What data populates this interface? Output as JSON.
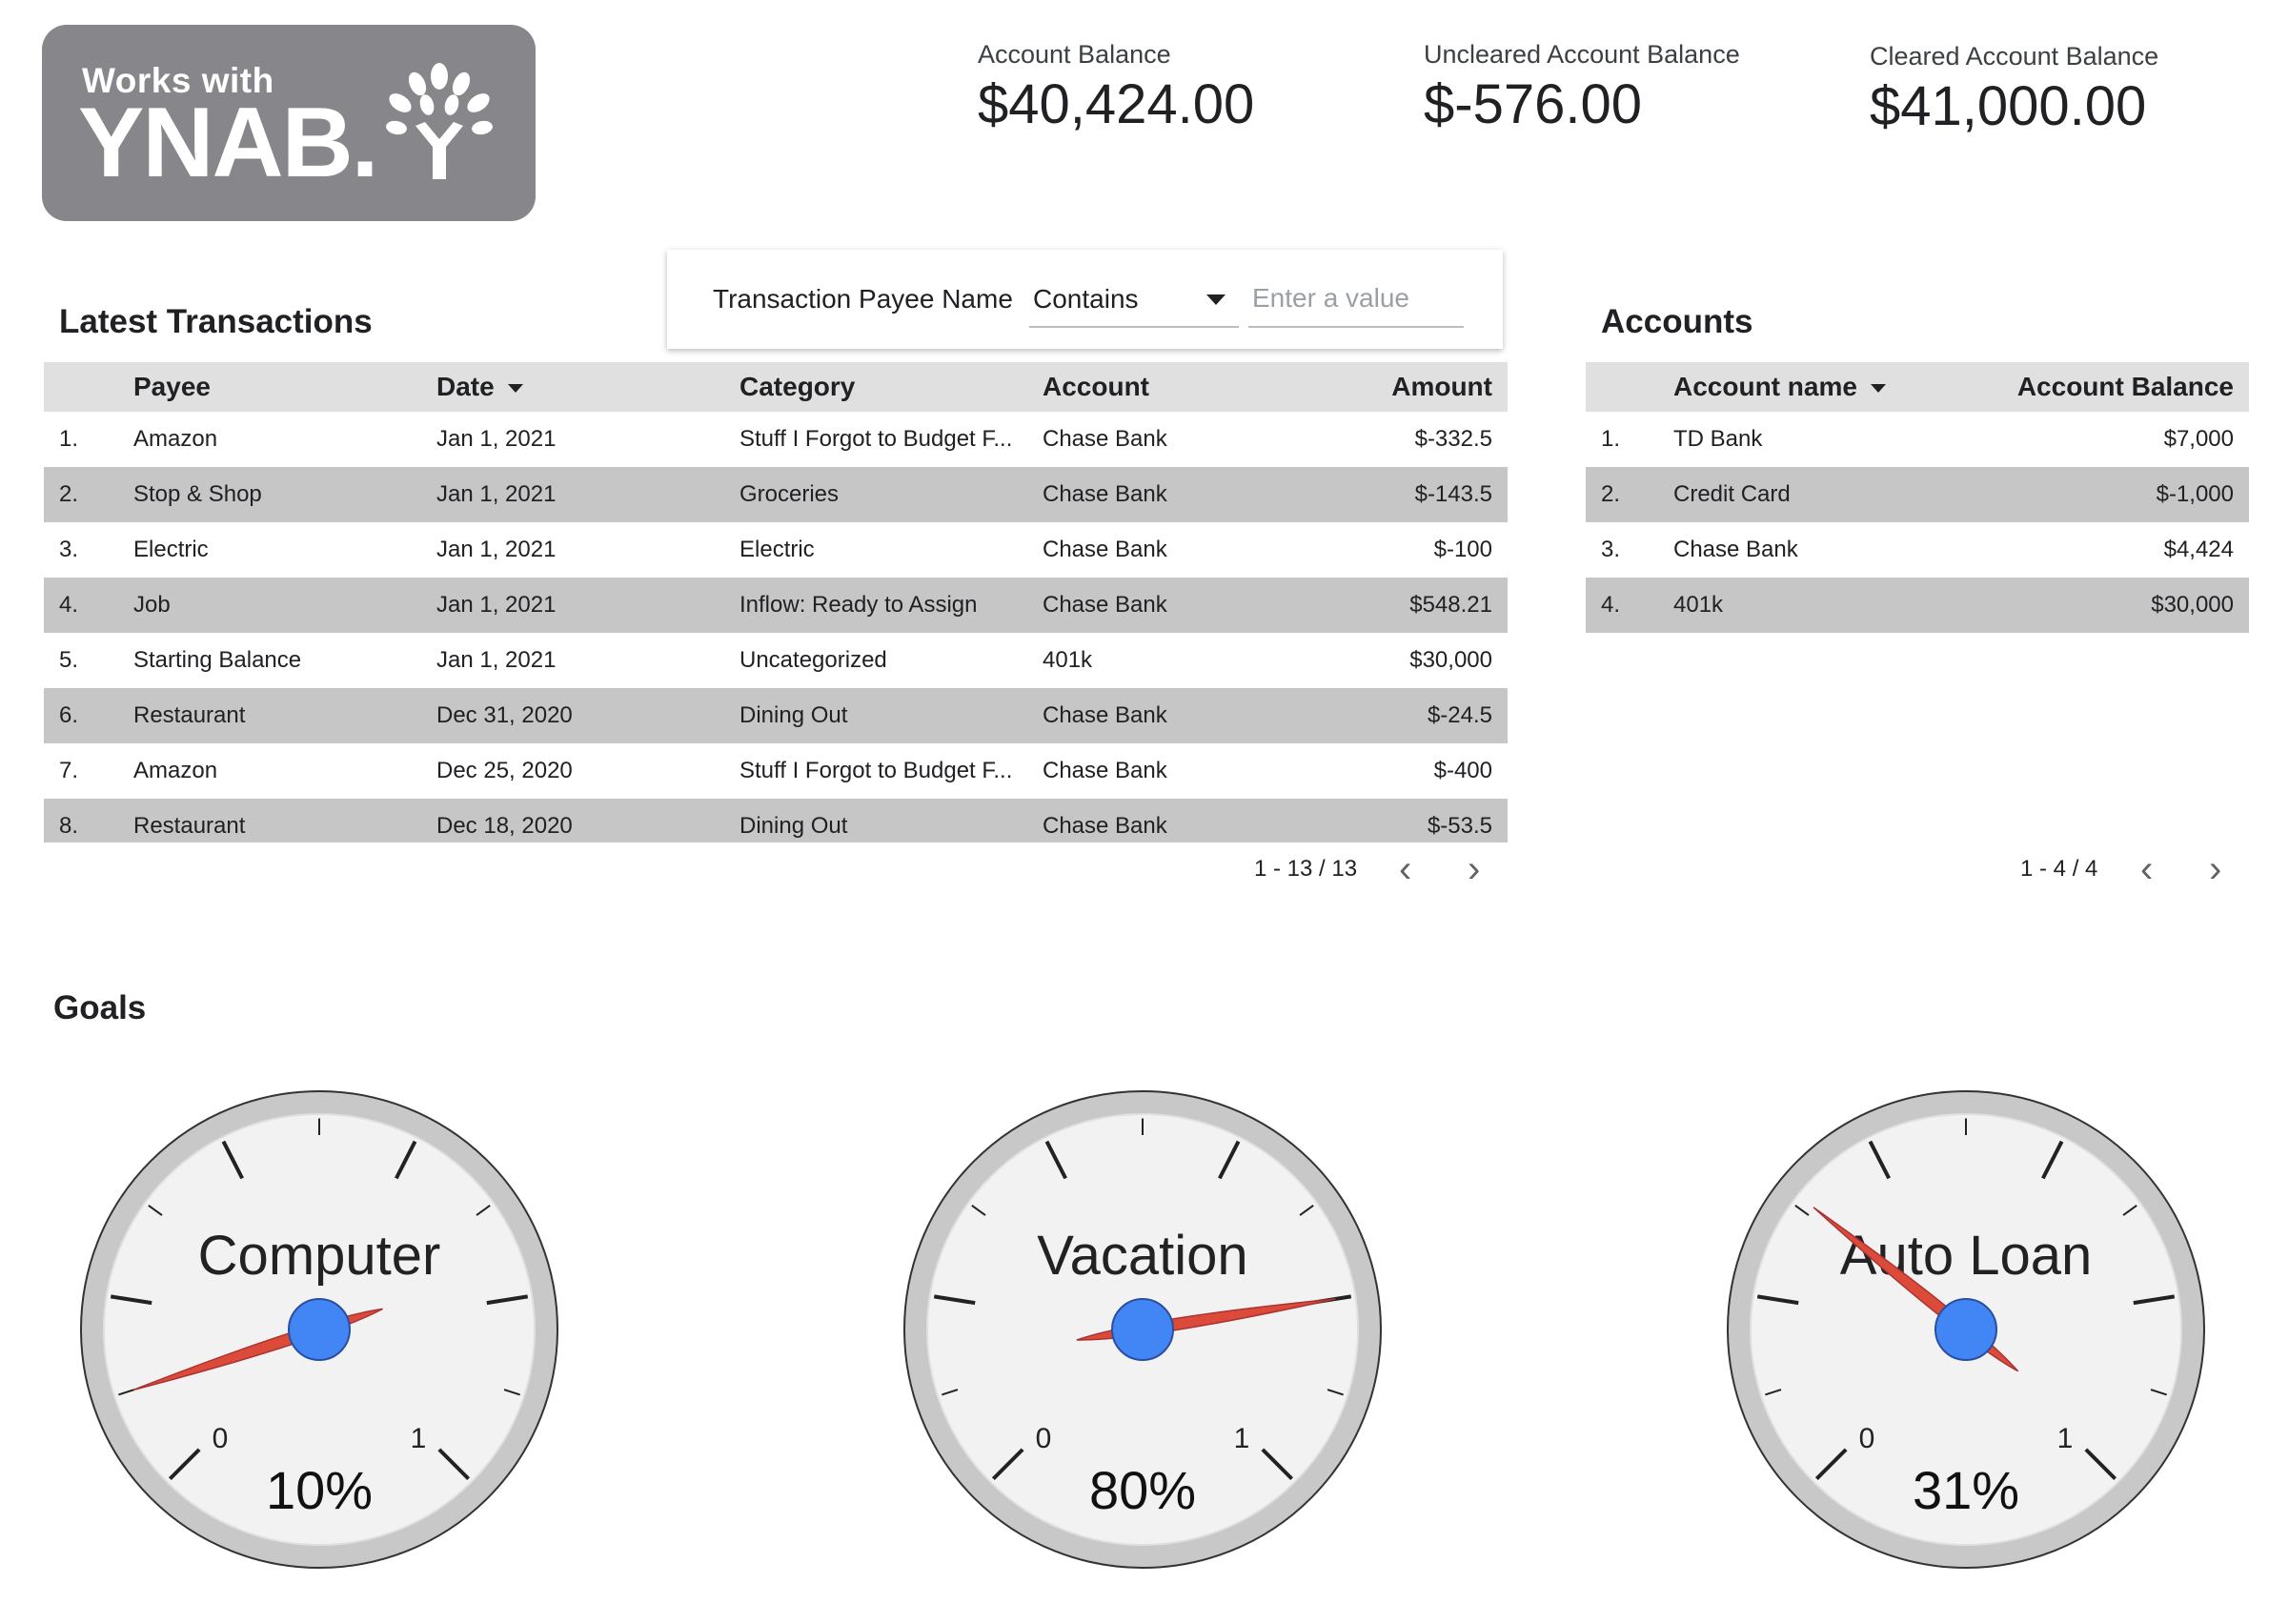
{
  "logo": {
    "line1": "Works with",
    "line2": "YNAB."
  },
  "kpis": [
    {
      "label": "Account Balance",
      "value": "$40,424.00"
    },
    {
      "label": "Uncleared Account Balance",
      "value": "$-576.00"
    },
    {
      "label": "Cleared Account Balance",
      "value": "$41,000.00"
    }
  ],
  "transactions": {
    "title": "Latest Transactions",
    "filter": {
      "label": "Transaction Payee Name",
      "operator": "Contains",
      "placeholder": "Enter a value"
    },
    "columns": [
      "Payee",
      "Date",
      "Category",
      "Account",
      "Amount"
    ],
    "rows": [
      {
        "n": "1.",
        "payee": "Amazon",
        "date": "Jan 1, 2021",
        "category": "Stuff I Forgot to Budget F...",
        "account": "Chase Bank",
        "amount": "$-332.5"
      },
      {
        "n": "2.",
        "payee": "Stop & Shop",
        "date": "Jan 1, 2021",
        "category": "Groceries",
        "account": "Chase Bank",
        "amount": "$-143.5"
      },
      {
        "n": "3.",
        "payee": "Electric",
        "date": "Jan 1, 2021",
        "category": "Electric",
        "account": "Chase Bank",
        "amount": "$-100"
      },
      {
        "n": "4.",
        "payee": "Job",
        "date": "Jan 1, 2021",
        "category": "Inflow: Ready to Assign",
        "account": "Chase Bank",
        "amount": "$548.21"
      },
      {
        "n": "5.",
        "payee": "Starting Balance",
        "date": "Jan 1, 2021",
        "category": "Uncategorized",
        "account": "401k",
        "amount": "$30,000"
      },
      {
        "n": "6.",
        "payee": "Restaurant",
        "date": "Dec 31, 2020",
        "category": "Dining Out",
        "account": "Chase Bank",
        "amount": "$-24.5"
      },
      {
        "n": "7.",
        "payee": "Amazon",
        "date": "Dec 25, 2020",
        "category": "Stuff I Forgot to Budget F...",
        "account": "Chase Bank",
        "amount": "$-400"
      },
      {
        "n": "8.",
        "payee": "Restaurant",
        "date": "Dec 18, 2020",
        "category": "Dining Out",
        "account": "Chase Bank",
        "amount": "$-53.5"
      }
    ],
    "pagination": "1 - 13 / 13"
  },
  "accounts": {
    "title": "Accounts",
    "columns": [
      "Account name",
      "Account Balance"
    ],
    "rows": [
      {
        "n": "1.",
        "name": "TD Bank",
        "balance": "$7,000"
      },
      {
        "n": "2.",
        "name": "Credit Card",
        "balance": "$-1,000"
      },
      {
        "n": "3.",
        "name": "Chase Bank",
        "balance": "$4,424"
      },
      {
        "n": "4.",
        "name": "401k",
        "balance": "$30,000"
      }
    ],
    "pagination": "1 - 4 / 4"
  },
  "goals": {
    "title": "Goals",
    "gauges": [
      {
        "name": "Computer",
        "value": 0.1,
        "label": "10%",
        "min_label": "0",
        "max_label": "1"
      },
      {
        "name": "Vacation",
        "value": 0.8,
        "label": "80%",
        "min_label": "0",
        "max_label": "1"
      },
      {
        "name": "Auto Loan",
        "value": 0.31,
        "label": "31%",
        "min_label": "0",
        "max_label": "1"
      }
    ]
  },
  "colors": {
    "needle": "#dc4b3a",
    "hub": "#4285f4",
    "gauge_face": "#f2f2f2",
    "gauge_rim": "#c8c8c8",
    "logo_bg": "#87878b"
  }
}
